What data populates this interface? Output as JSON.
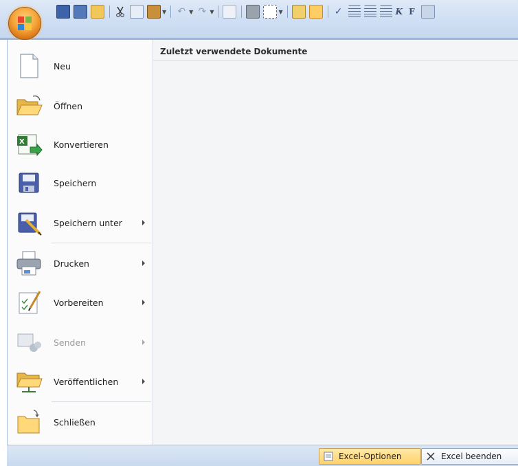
{
  "menu": {
    "items": [
      {
        "label": "Neu",
        "submenu": false,
        "enabled": true
      },
      {
        "label": "Öffnen",
        "submenu": false,
        "enabled": true
      },
      {
        "label": "Konvertieren",
        "submenu": false,
        "enabled": true
      },
      {
        "label": "Speichern",
        "submenu": false,
        "enabled": true
      },
      {
        "label": "Speichern unter",
        "submenu": true,
        "enabled": true
      },
      {
        "label": "Drucken",
        "submenu": true,
        "enabled": true
      },
      {
        "label": "Vorbereiten",
        "submenu": true,
        "enabled": true
      },
      {
        "label": "Senden",
        "submenu": true,
        "enabled": false
      },
      {
        "label": "Veröffentlichen",
        "submenu": true,
        "enabled": true
      },
      {
        "label": "Schließen",
        "submenu": false,
        "enabled": true
      }
    ]
  },
  "recent": {
    "title": "Zuletzt verwendete Dokumente"
  },
  "footer": {
    "options_label": "Excel-Optionen",
    "exit_label": "Excel beenden"
  },
  "toolbar": {
    "bold_glyph": "K",
    "font_glyph": "F"
  },
  "colors": {
    "office_orange": "#f6a53a",
    "ribbon_blue": "#c4d6ee",
    "options_button": "#ffd36b"
  }
}
